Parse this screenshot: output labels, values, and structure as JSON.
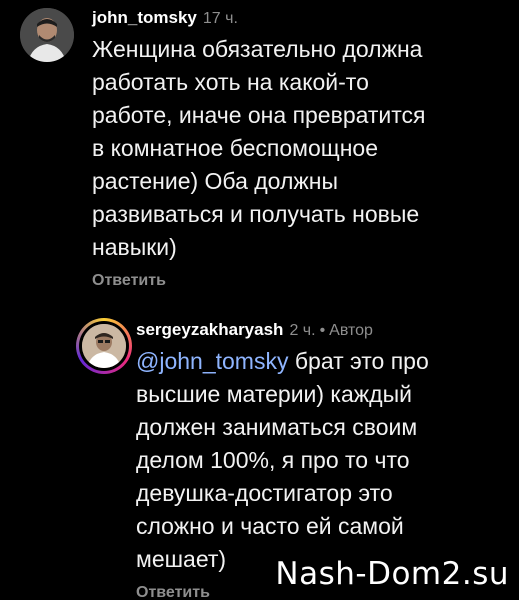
{
  "comment": {
    "username": "john_tomsky",
    "time": "17 ч.",
    "text": "Женщина обязательно должна\nработать хоть на какой-то\nработе, иначе она превратится\nв комнатное беспомощное\nрастение) Оба должны\nразвиваться и получать новые\nнавыки)",
    "reply_label": "Ответить"
  },
  "reply": {
    "username": "sergeyzakharyash",
    "time": "2 ч.",
    "separator": "•",
    "author_label": "Автор",
    "mention": "@john_tomsky",
    "text_first_line": " брат это про",
    "text_rest": "высшие материи) каждый\nдолжен заниматься своим\nделом 100%, я про то что\nдевушка-достигатор это\nсложно и часто ей самой\nмешает)",
    "reply_label": "Ответить"
  },
  "watermark": "Nash-Dom2.su"
}
